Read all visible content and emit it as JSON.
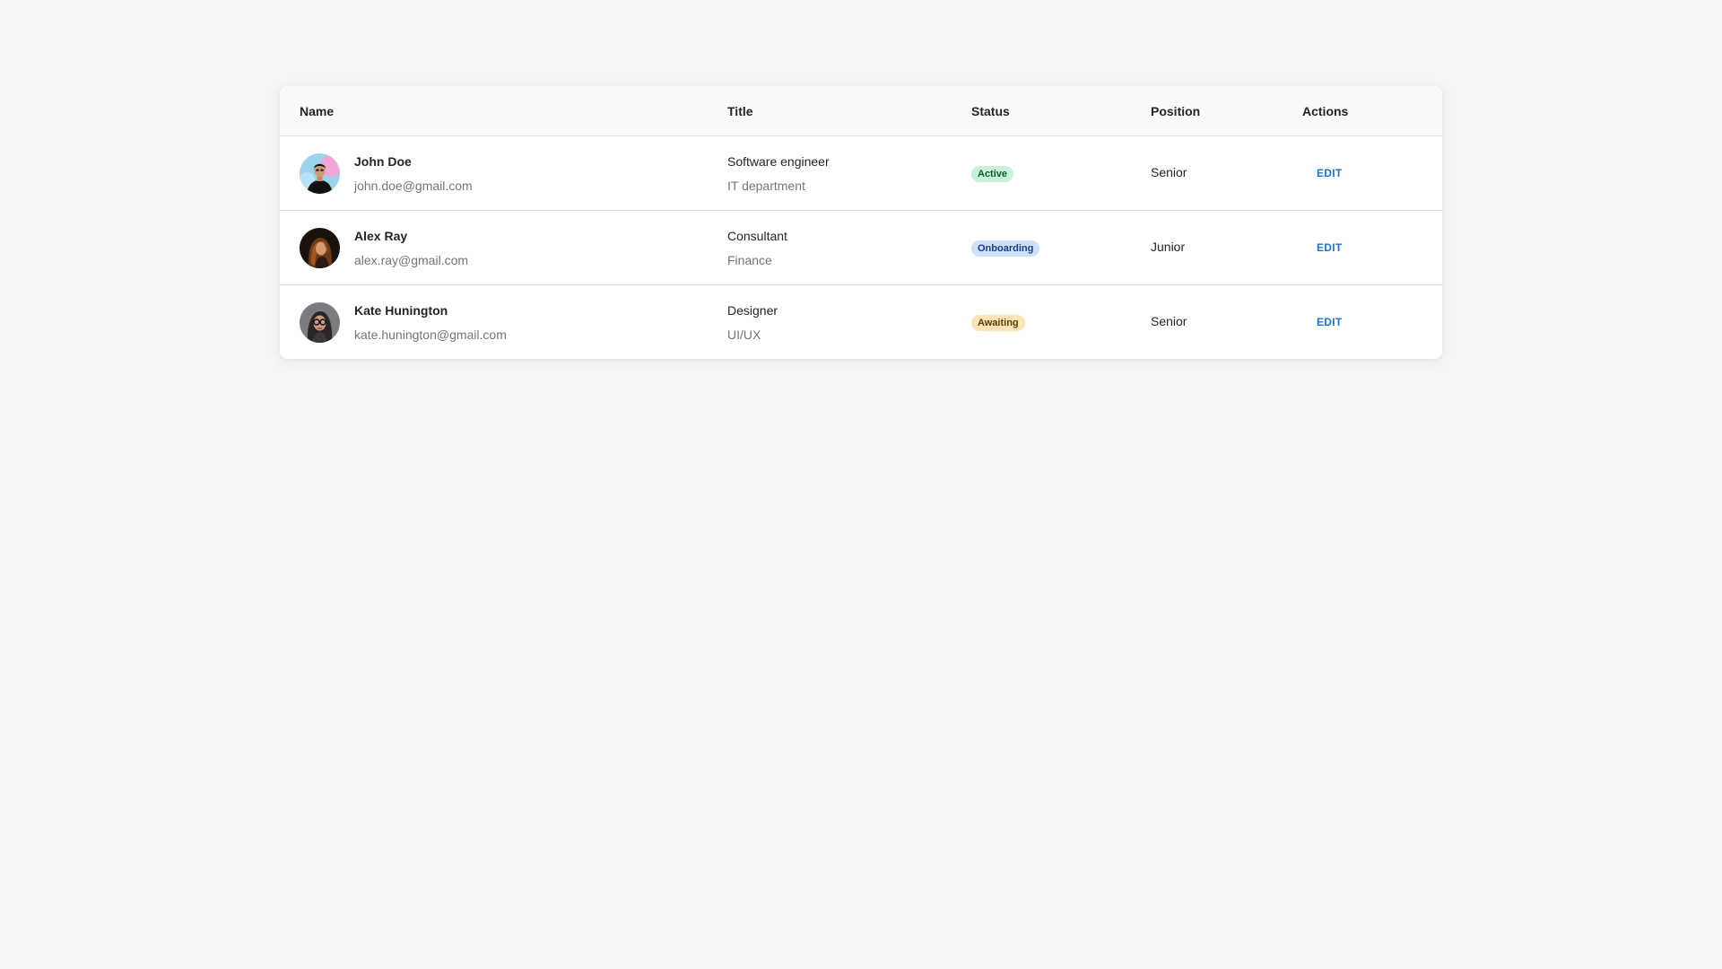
{
  "table": {
    "headers": {
      "name": "Name",
      "title": "Title",
      "status": "Status",
      "position": "Position",
      "actions": "Actions"
    },
    "rows": [
      {
        "name": "John Doe",
        "email": "john.doe@gmail.com",
        "title": "Software engineer",
        "department": "IT department",
        "status": "Active",
        "status_bg": "#c8f2d8",
        "status_color": "#0a5c2e",
        "position": "Senior",
        "action": "EDIT",
        "avatar_icon": "man-avatar"
      },
      {
        "name": "Alex Ray",
        "email": "alex.ray@gmail.com",
        "title": "Consultant",
        "department": "Finance",
        "status": "Onboarding",
        "status_bg": "#cfe0fa",
        "status_color": "#123d8a",
        "position": "Junior",
        "action": "EDIT",
        "avatar_icon": "woman-avatar"
      },
      {
        "name": "Kate Hunington",
        "email": "kate.hunington@gmail.com",
        "title": "Designer",
        "department": "UI/UX",
        "status": "Awaiting",
        "status_bg": "#fde5b8",
        "status_color": "#5a3a00",
        "position": "Senior",
        "action": "EDIT",
        "avatar_icon": "woman-glasses-avatar"
      }
    ]
  },
  "colors": {
    "accent": "#1976d2",
    "background": "#f5f5f5"
  }
}
